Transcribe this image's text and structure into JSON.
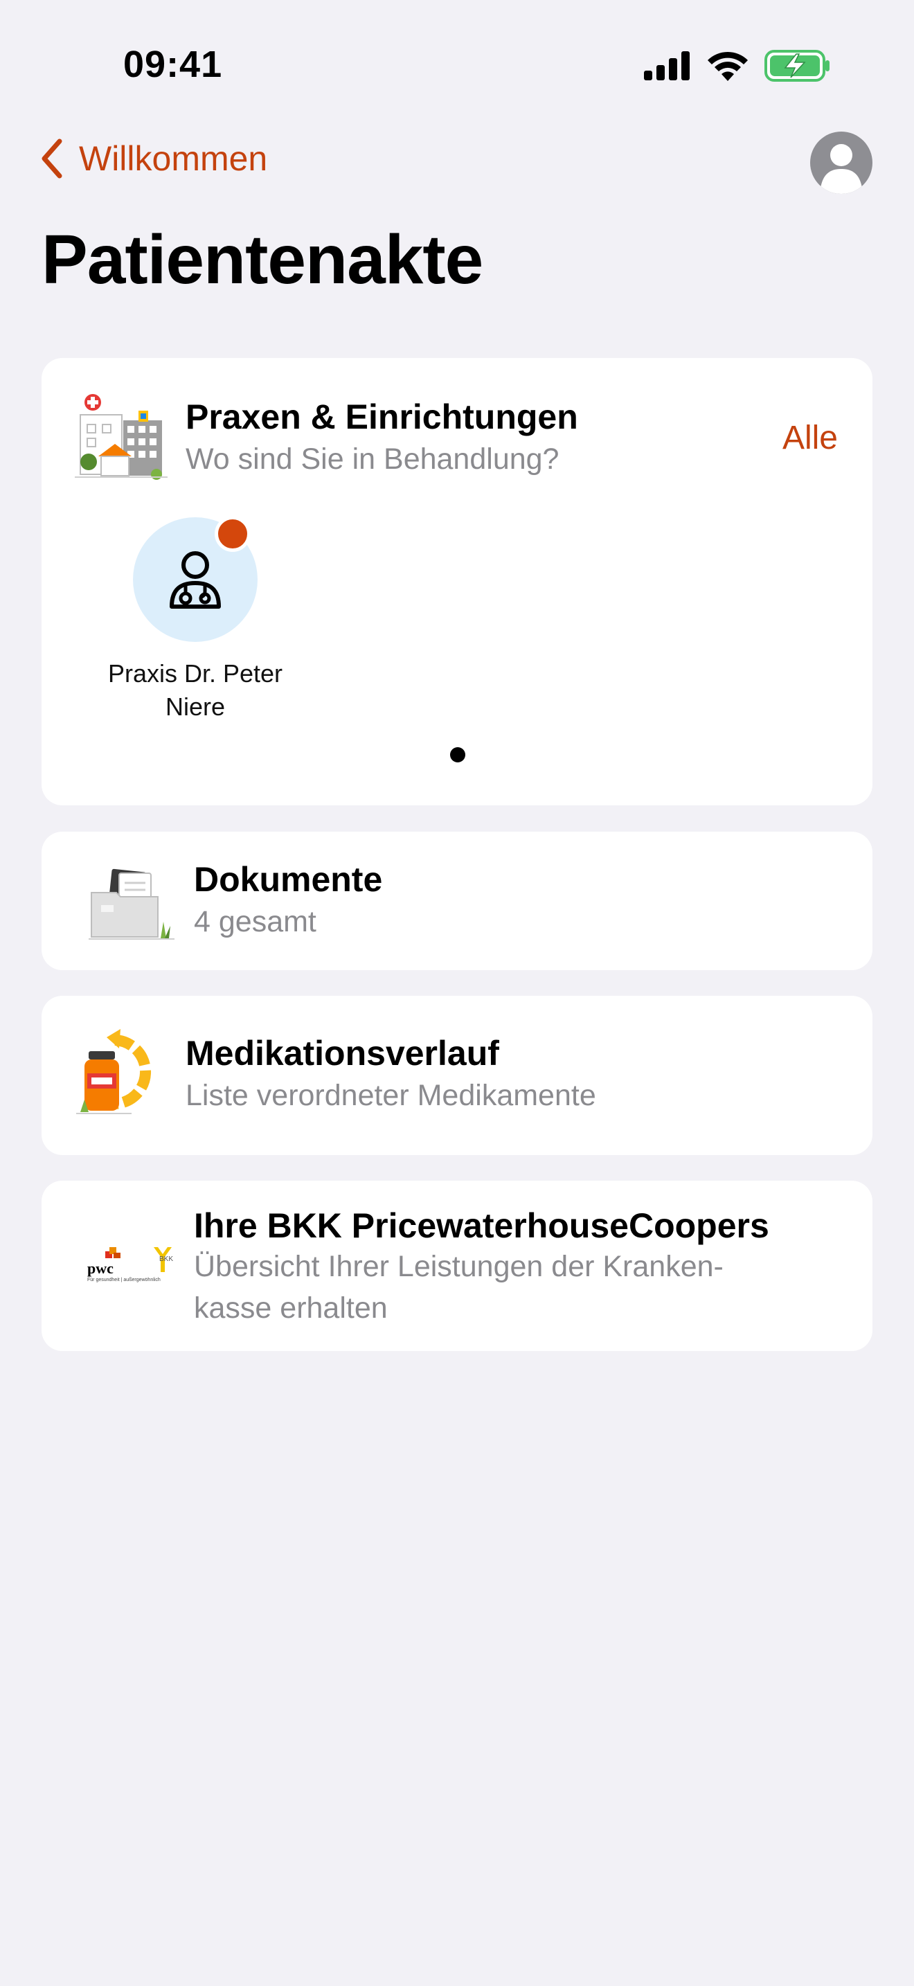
{
  "status_bar": {
    "time": "09:41"
  },
  "nav": {
    "back_label": "Willkommen",
    "title": "Patientenakte"
  },
  "providers": {
    "title": "Praxen & Einrichtungen",
    "subtitle": "Wo sind Sie in Behandlung?",
    "all_link": "Alle",
    "items": [
      {
        "name": "Praxis Dr. Peter Niere",
        "has_notification": true
      }
    ],
    "page_count": 1,
    "current_page": 1
  },
  "documents": {
    "title": "Dokumente",
    "subtitle": "4 gesamt"
  },
  "medication": {
    "title": "Medikationsverlauf",
    "subtitle": "Liste verordneter Medikamente"
  },
  "insurance": {
    "title": "Ihre BKK PricewaterhouseCoopers",
    "subtitle": "Übersicht Ihrer Leistungen der Kranken-kasse erhalten",
    "logo_text_pwc": "pwc",
    "logo_text_bkk": "BKK",
    "logo_tagline": "Für gesundheit | außergewöhnlich"
  },
  "colors": {
    "accent": "#C4420E",
    "background": "#F2F1F6",
    "card": "#FFFFFF",
    "badge": "#D4470C",
    "tile": "#DCEEFB"
  }
}
